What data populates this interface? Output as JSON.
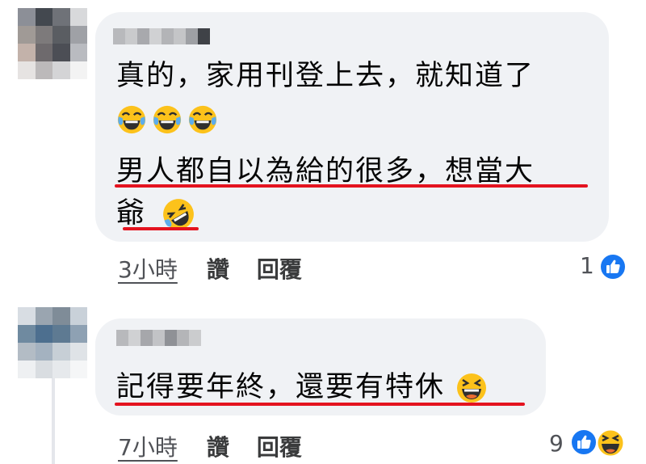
{
  "colors": {
    "bubble": "#f0f2f5",
    "underline": "#e4131f",
    "like_blue": "#1877f2",
    "meta_text": "#505257"
  },
  "comments": [
    {
      "author": "",
      "lines": [
        "真的，家用刊登上去，就知道了",
        "男人都自以為給的很多，想當大",
        "爺"
      ],
      "emoji_row": [
        "joy-emoji",
        "joy-emoji",
        "joy-emoji"
      ],
      "inline_emoji": "rofl-emoji",
      "time": "3小時",
      "like_label": "讚",
      "reply_label": "回覆",
      "reaction_count": "1",
      "reactions": [
        "like-icon"
      ]
    },
    {
      "author": "",
      "lines": [
        "記得要年終，還要有特休"
      ],
      "inline_emoji": "laughing-emoji",
      "time": "7小時",
      "like_label": "讚",
      "reply_label": "回覆",
      "reaction_count": "9",
      "reactions": [
        "like-icon",
        "haha-icon"
      ]
    }
  ]
}
